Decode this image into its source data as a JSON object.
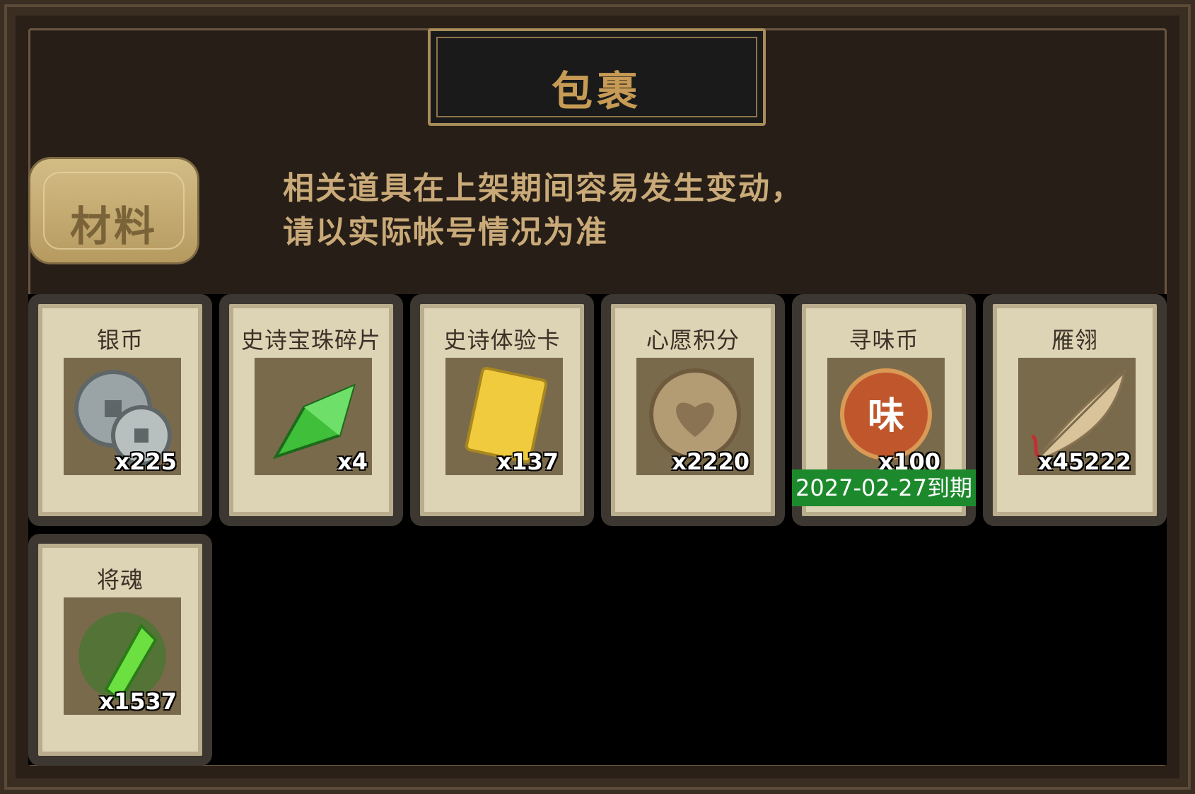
{
  "title": "包裹",
  "tab": {
    "label": "材料"
  },
  "notice": {
    "line1": "相关道具在上架期间容易发生变动，",
    "line2": "请以实际帐号情况为准"
  },
  "items": [
    {
      "name": "银币",
      "count": "x225",
      "icon": "silver-coin-icon"
    },
    {
      "name": "史诗宝珠碎片",
      "count": "x4",
      "icon": "green-gem-shard-icon"
    },
    {
      "name": "史诗体验卡",
      "count": "x137",
      "icon": "gold-card-icon"
    },
    {
      "name": "心愿积分",
      "count": "x2220",
      "icon": "heart-coin-icon"
    },
    {
      "name": "寻味币",
      "count": "x100",
      "icon": "flavor-coin-icon",
      "expiry": "2027-02-27到期"
    },
    {
      "name": "雁翎",
      "count": "x45222",
      "icon": "feather-icon"
    },
    {
      "name": "将魂",
      "count": "x1537",
      "icon": "green-crystal-icon"
    }
  ],
  "colors": {
    "gold": "#c79b55",
    "panel": "#271e17",
    "card": "#ddd3b5",
    "expiry": "#1c8a2c"
  }
}
